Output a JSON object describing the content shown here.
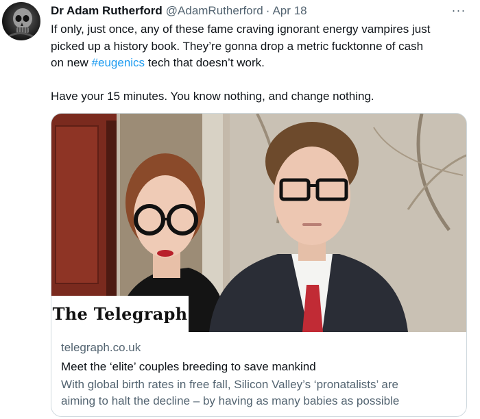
{
  "author": {
    "name": "Dr Adam Rutherford",
    "handle": "@AdamRutherford",
    "separator": "·",
    "date": "Apr 18",
    "avatar_icon": "skull-avatar-icon"
  },
  "more_menu": {
    "label": "···"
  },
  "tweet": {
    "line1": "If only, just once, any of these fame craving ignorant energy vampires just",
    "line2": "picked up a history book. They’re gonna drop a metric fucktonne of cash",
    "line3_before": "on new ",
    "hashtag": "#eugenics",
    "line3_after": " tech that doesn’t work.",
    "line4": "Have your 15 minutes. You know nothing, and change nothing."
  },
  "card": {
    "brand": "The Telegraph",
    "domain": "telegraph.co.uk",
    "title": "Meet the ‘elite’ couples breeding to save mankind",
    "description_line1": "With global birth rates in free fall, Silicon Valley’s ‘pronatalists’ are",
    "description_line2": "aiming to halt the decline – by having as many babies as possible"
  },
  "colors": {
    "text": "#0f1419",
    "muted": "#536471",
    "link": "#1d9bf0",
    "border": "#cfd9de"
  }
}
